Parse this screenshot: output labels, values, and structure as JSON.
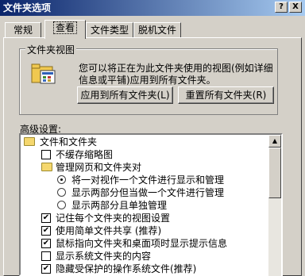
{
  "window": {
    "title": "文件夹选项",
    "help_button": "?",
    "close_button": "X"
  },
  "tabs": [
    {
      "label": "常规"
    },
    {
      "label": "查看"
    },
    {
      "label": "文件类型"
    },
    {
      "label": "脱机文件"
    }
  ],
  "folder_views": {
    "group_title": "文件夹视图",
    "description": "您可以将正在为此文件夹使用的视图(例如详细信息或平铺)应用到所有文件夹。",
    "apply_all_button": "应用到所有文件夹(L)",
    "reset_all_button": "重置所有文件夹(R)"
  },
  "advanced": {
    "label": "高级设置:",
    "items": [
      {
        "type": "folder",
        "label": "文件和文件夹"
      },
      {
        "type": "checkbox",
        "checked": false,
        "label": "不缓存缩略图"
      },
      {
        "type": "folder",
        "label": "管理网页和文件夹对"
      },
      {
        "type": "radio",
        "checked": true,
        "label": "将一对视作一个文件进行显示和管理"
      },
      {
        "type": "radio",
        "checked": false,
        "label": "显示两部分但当做一个文件进行管理"
      },
      {
        "type": "radio",
        "checked": false,
        "label": "显示两部分且单独管理"
      },
      {
        "type": "checkbox",
        "checked": true,
        "label": "记住每个文件夹的视图设置"
      },
      {
        "type": "checkbox",
        "checked": true,
        "label": "使用简单文件共享 (推荐)"
      },
      {
        "type": "checkbox",
        "checked": true,
        "label": "鼠标指向文件夹和桌面项时显示提示信息"
      },
      {
        "type": "checkbox",
        "checked": false,
        "label": "显示系统文件夹的内容"
      },
      {
        "type": "checkbox",
        "checked": true,
        "label": "隐藏受保护的操作系统文件(推荐)"
      }
    ]
  }
}
